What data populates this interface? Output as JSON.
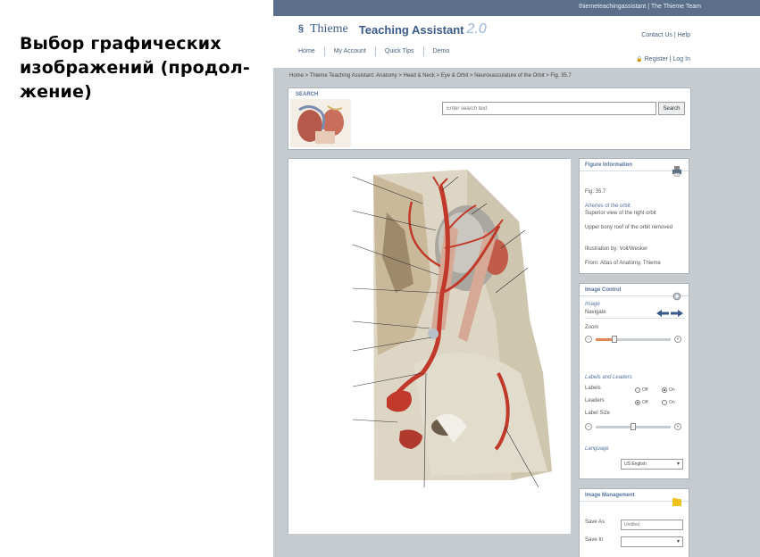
{
  "slide": {
    "title_line1": "Выбор графических",
    "title_line2": "изображений (продол-",
    "title_line3": "жение)"
  },
  "app": {
    "topbar_links": "thiemeteachingassistant | The Thieme Team",
    "logo": {
      "wordmark": "Thieme",
      "app_name": "Teaching Assistant",
      "version": "2.0"
    },
    "header_links": {
      "contact": "Contact Us | Help",
      "auth": "Register | Log In"
    },
    "nav": [
      "Home",
      "My Account",
      "Quick Tips",
      "Demo"
    ],
    "breadcrumb": "Home > Thieme Teaching Assistant: Anatomy > Head & Neck > Eye & Orbit > Neurovasculature of the Orbit > Fig. 35.7",
    "search": {
      "label": "SEARCH",
      "placeholder": "Enter search text",
      "button": "Search"
    },
    "figure_info": {
      "title": "Figure Information",
      "fig_no": "Fig. 35.7",
      "caption_title": "Arteries of the orbit",
      "caption_line1": "Superior view of the right orbit",
      "caption_line2": "Upper bony roof of the orbit removed",
      "illustrator": "Illustration by: Voll/Wesker",
      "source": "From: Atlas of Anatomy, Thieme"
    },
    "image_control": {
      "title": "Image Control",
      "image_heading": "Image",
      "navigate": "Navigate",
      "zoom": "Zoom",
      "zoom_level": 0.25,
      "labels_heading": "Labels and Leaders",
      "labels": "Labels",
      "leaders": "Leaders",
      "label_size": "Label Size",
      "label_size_level": 0.5,
      "off": "Off",
      "on": "On",
      "language_heading": "Language",
      "language_value": "US English"
    },
    "image_management": {
      "title": "Image Management",
      "save_as": "Save As",
      "save_as_value": "Untitled",
      "save_in": "Save In"
    },
    "colors": {
      "topbar": "#5b6e8a",
      "accent": "#56729c",
      "slider": "#e0875a",
      "artery": "#c0392b"
    }
  }
}
